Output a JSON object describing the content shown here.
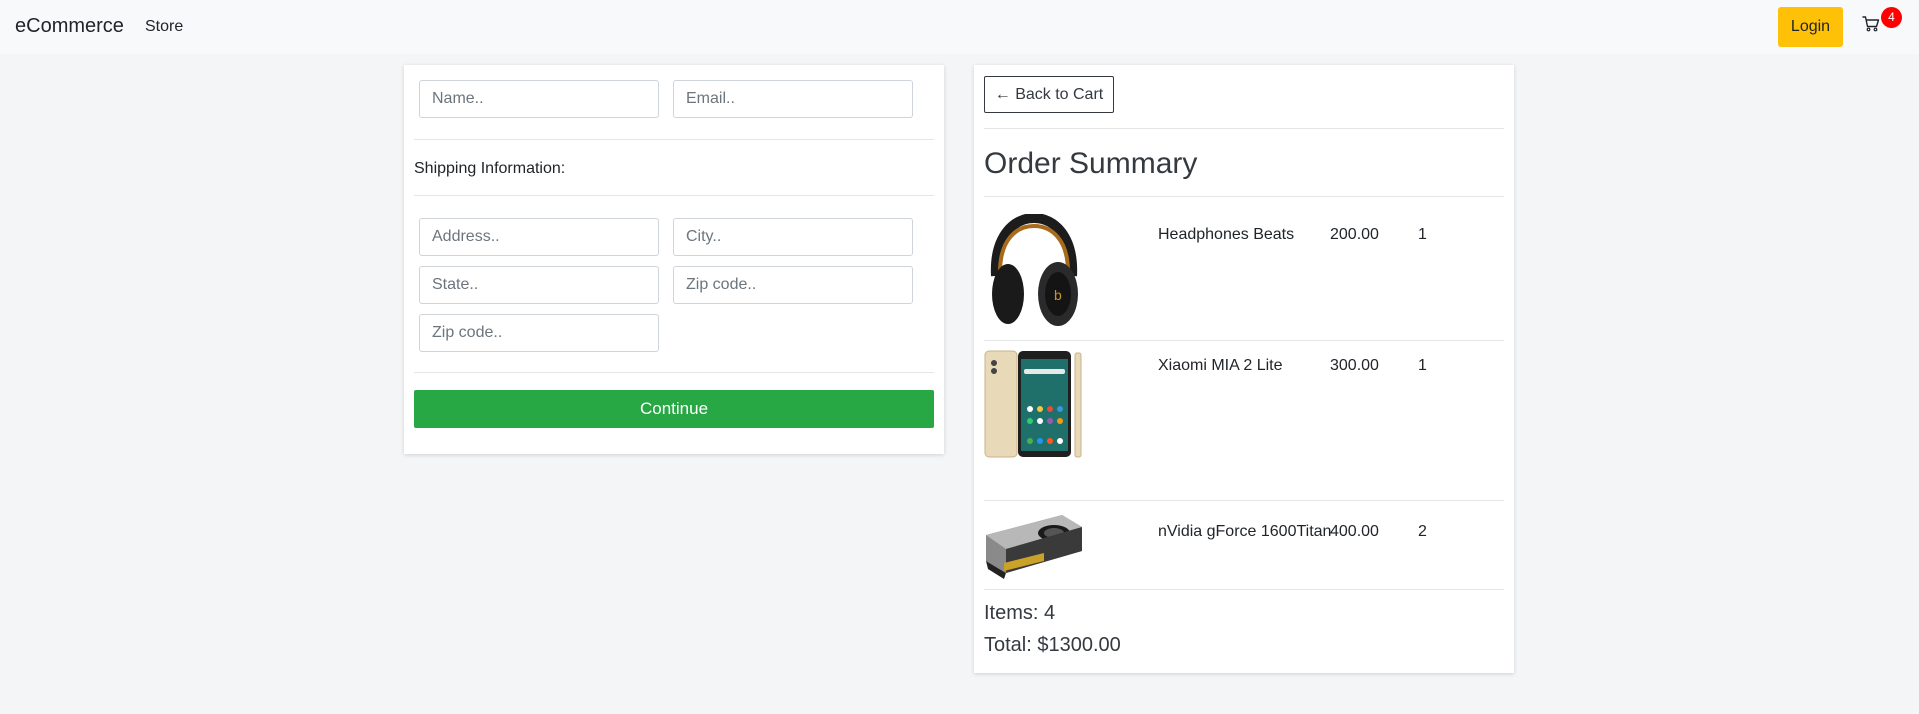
{
  "navbar": {
    "brand": "eCommerce",
    "store_link": "Store",
    "login_label": "Login",
    "cart_count": "4",
    "cart_icon": "cart-icon"
  },
  "form": {
    "name_placeholder": "Name..",
    "email_placeholder": "Email..",
    "shipping_title": "Shipping Information:",
    "address_placeholder": "Address..",
    "city_placeholder": "City..",
    "state_placeholder": "State..",
    "zip_placeholder": "Zip code..",
    "zip2_placeholder": "Zip code..",
    "continue_label": "Continue",
    "continue_color": "#28a745"
  },
  "summary": {
    "back_label": "← Back to Cart",
    "title": "Order Summary",
    "items": [
      {
        "name": "Headphones Beats",
        "price": "200.00",
        "qty": "1",
        "image": "headphones"
      },
      {
        "name": "Xiaomi MIA 2 Lite",
        "price": "300.00",
        "qty": "1",
        "image": "smartphone"
      },
      {
        "name": "nVidia gForce 1600Titan",
        "price": "400.00",
        "qty": "2",
        "image": "graphics-card"
      }
    ],
    "items_count": "Items: 4",
    "total": "Total: $1300.00"
  },
  "colors": {
    "login": "#ffc107",
    "badge": "#ff0000"
  }
}
